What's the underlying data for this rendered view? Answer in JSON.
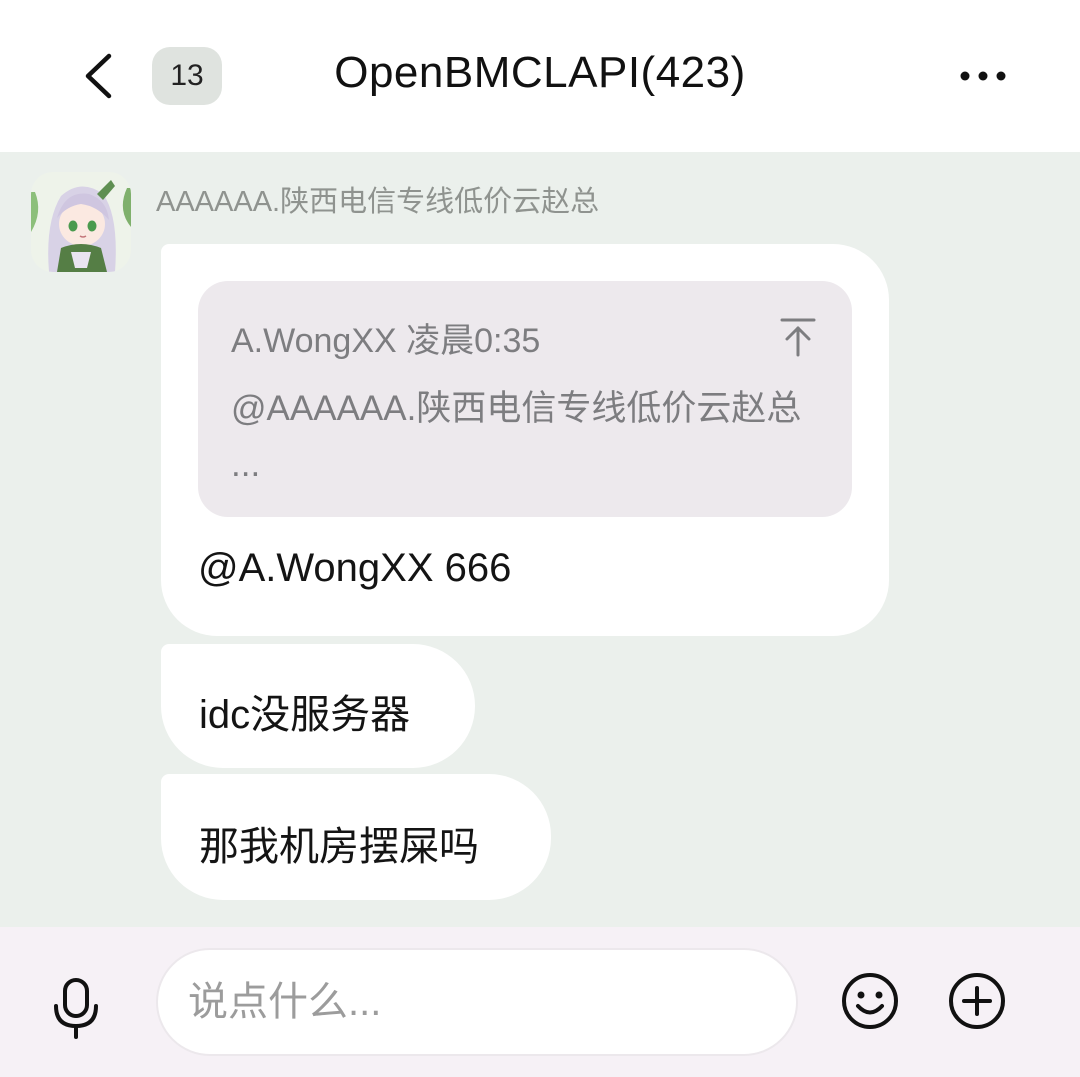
{
  "header": {
    "title": "OpenBMCLAPI(423)",
    "unread_count": "13",
    "icons": {
      "back": "chevron-left-icon",
      "more": "more-horizontal-icon"
    }
  },
  "chat": {
    "messages": [
      {
        "sender": "AAAAAA.陕西电信专线低价云赵总",
        "avatar": "anime-character-avatar",
        "quote": {
          "meta": "A.WongXX 凌晨0:35",
          "text": "@AAAAAA.陕西电信专线低价云赵总 ...",
          "icon": "jump-to-top-icon"
        },
        "text": "@A.WongXX 666"
      },
      {
        "text": "idc没服务器"
      },
      {
        "text": "那我机房摆屎吗"
      }
    ]
  },
  "input_bar": {
    "placeholder": "说点什么...",
    "icons": {
      "voice": "microphone-icon",
      "emoji": "smiley-icon",
      "more": "plus-circle-icon"
    }
  },
  "colors": {
    "chat_background": "#ebf0ec",
    "bubble": "#ffffff",
    "quote_background": "#ede9ed",
    "input_bar_background": "#f6f1f6",
    "badge_background": "#dfe3df"
  }
}
